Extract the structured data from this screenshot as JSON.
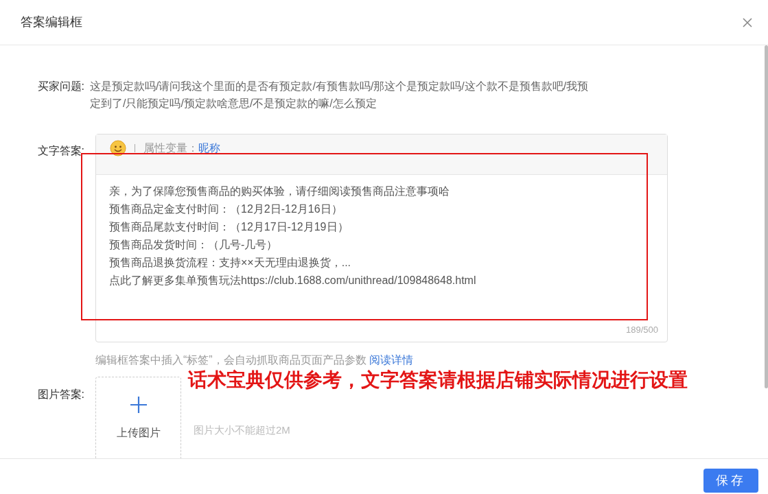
{
  "dialog": {
    "title": "答案编辑框"
  },
  "question": {
    "label": "买家问题:",
    "text": "这是预定款吗/请问我这个里面的是否有预定款/有预售款吗/那这个是预定款吗/这个款不是预售款吧/我预定到了/只能预定吗/预定款啥意思/不是预定款的嘛/怎么预定"
  },
  "text_answer": {
    "label": "文字答案:",
    "toolbar": {
      "variable_label": "属性变量：",
      "variable": "昵称"
    },
    "lines": [
      "亲，为了保障您预售商品的购买体验，请仔细阅读预售商品注意事项哈",
      "预售商品定金支付时间：（12月2日-12月16日）",
      "预售商品尾款支付时间：（12月17日-12月19日）",
      "预售商品发货时间：（几号-几号）",
      "预售商品退换货流程：支持××天无理由退换货，...",
      "点此了解更多集单预售玩法https://club.1688.com/unithread/109848648.html"
    ],
    "counter": "189/500"
  },
  "hint": {
    "text": "编辑框答案中插入“标签”，会自动抓取商品页面产品参数",
    "link": "阅读详情"
  },
  "notice": "话术宝典仅供参考，文字答案请根据店铺实际情况进行设置",
  "image_answer": {
    "label": "图片答案:",
    "upload_label": "上传图片",
    "size_hint": "图片大小不能超过2M"
  },
  "footer": {
    "save": "保存"
  }
}
